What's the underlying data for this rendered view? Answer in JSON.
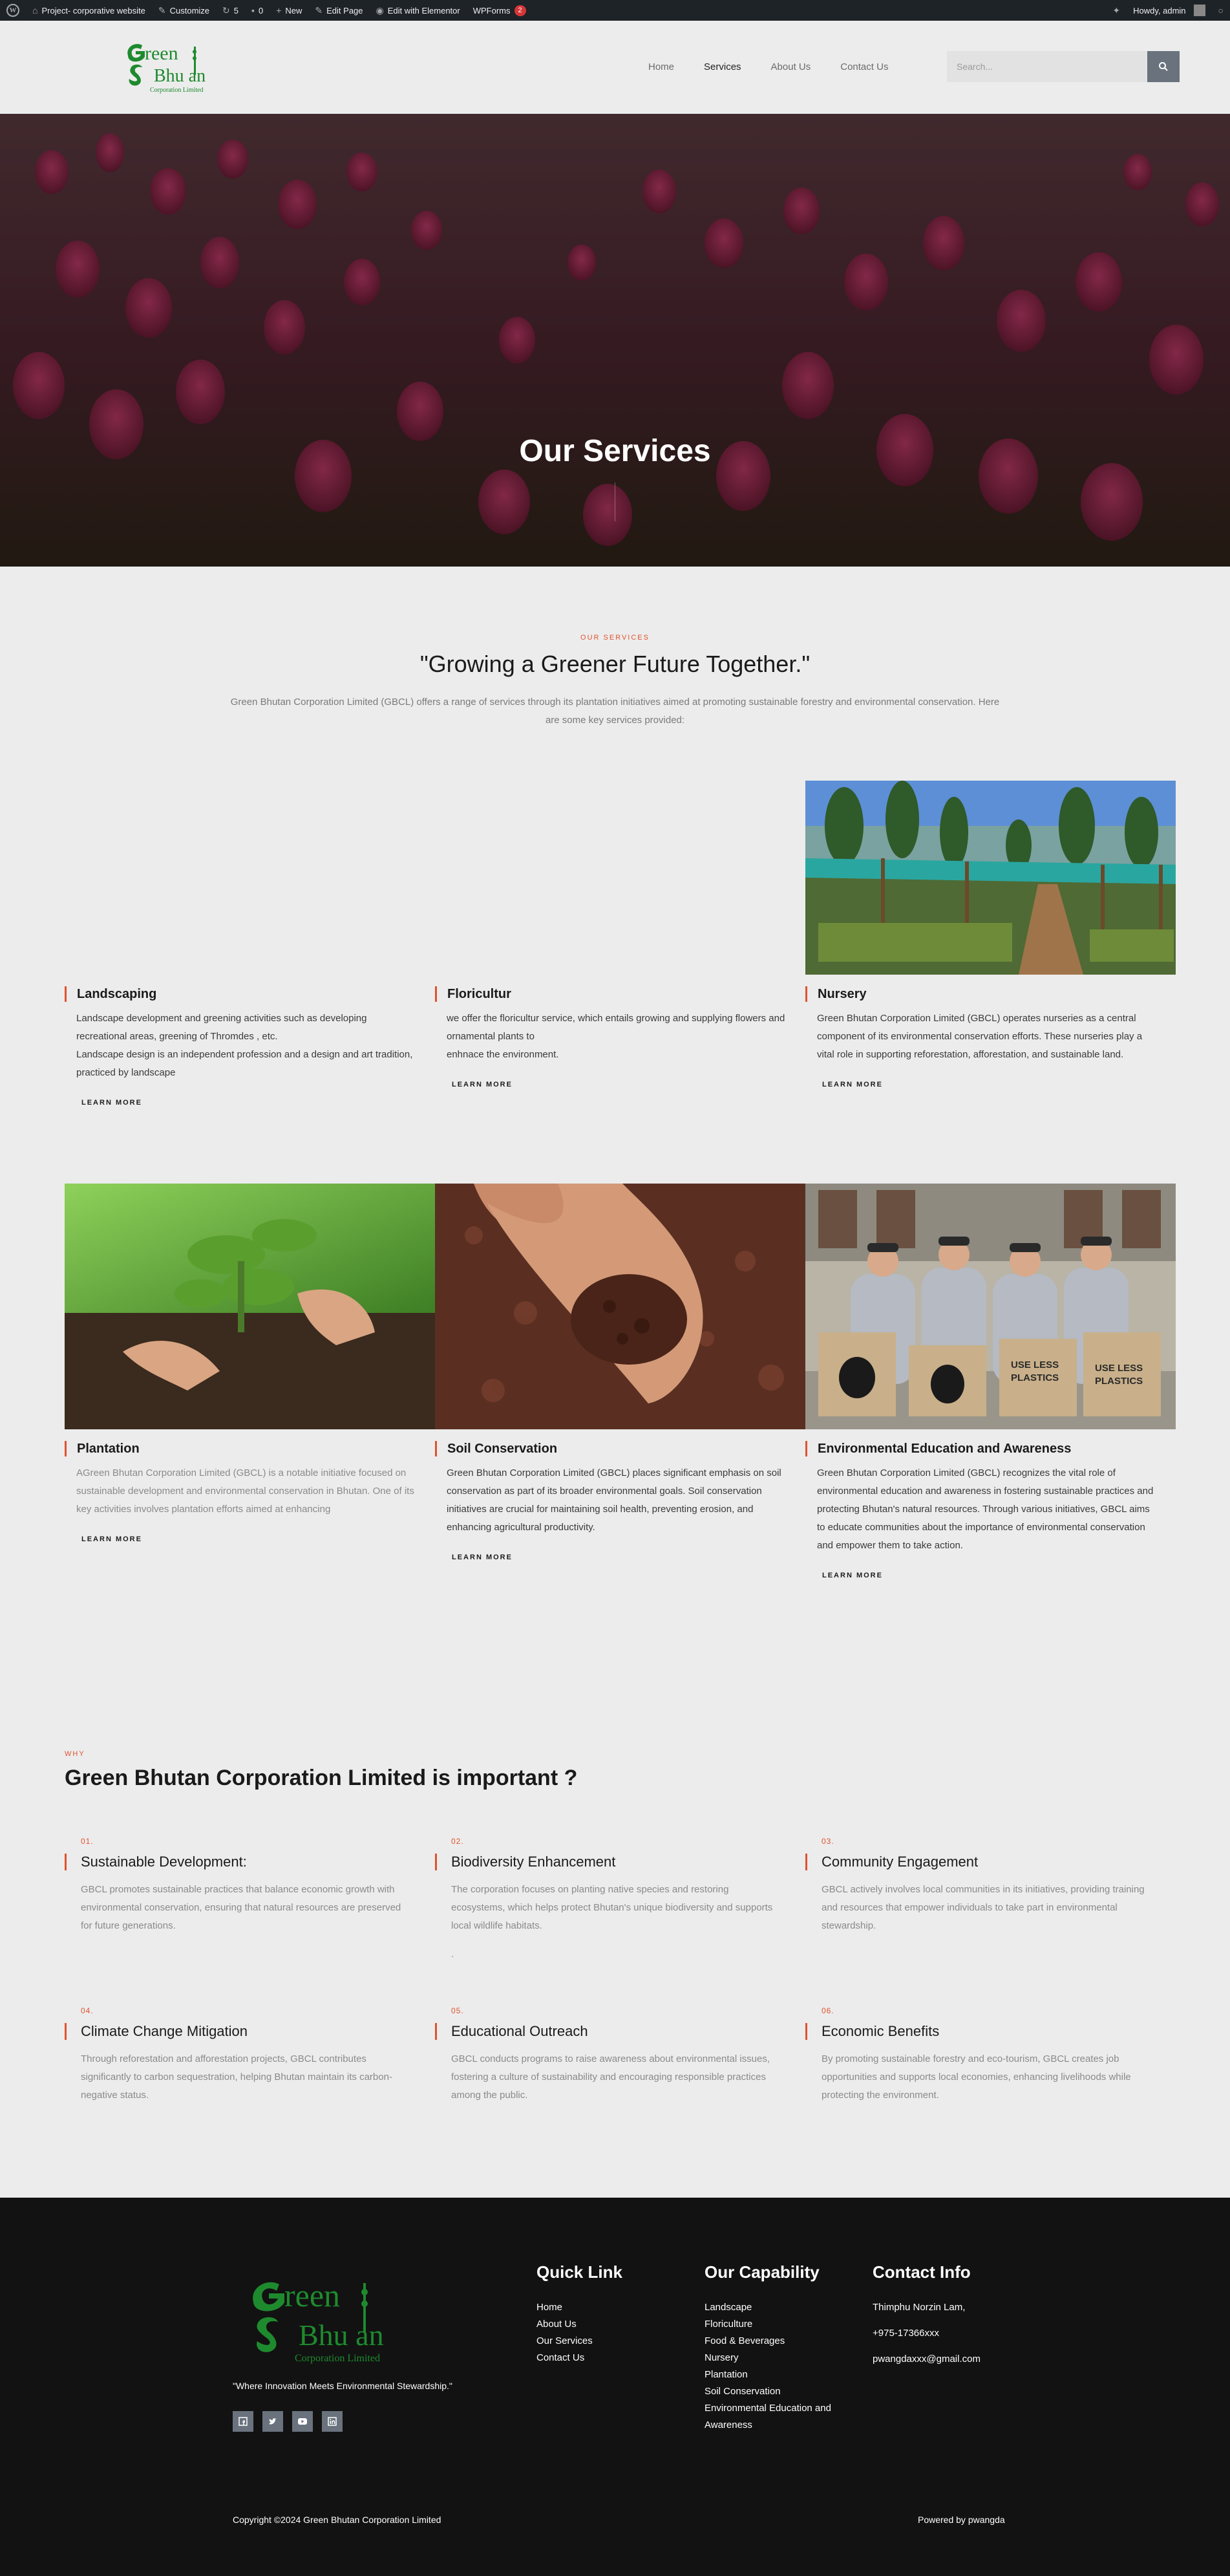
{
  "admin_bar": {
    "site_name": "Project- corporative website",
    "customize": "Customize",
    "updates_count": "5",
    "comments_count": "0",
    "new": "New",
    "edit_page": "Edit Page",
    "edit_elementor": "Edit with Elementor",
    "wpforms": "WPForms",
    "wpforms_badge": "2",
    "howdy": "Howdy, admin"
  },
  "header": {
    "logo_word1": "reen",
    "logo_word2": "Bhu an",
    "logo_sub": "Corporation Limited",
    "nav": [
      "Home",
      "Services",
      "About Us",
      "Contact Us"
    ],
    "active_nav": "Services",
    "search_placeholder": "Search..."
  },
  "hero": {
    "title": "Our Services"
  },
  "intro": {
    "eyebrow": "OUR SERVICES",
    "title": "\"Growing a Greener Future Together.\"",
    "text": "Green Bhutan Corporation Limited (GBCL) offers a range of services through its plantation initiatives aimed at promoting sustainable forestry and environmental conservation. Here are some key services provided:"
  },
  "services": [
    {
      "title": "Landscaping",
      "lines": [
        "Landscape development and greening activities such as developing recreational areas, greening of Thromdes , etc.",
        "Landscape design is an independent profession and a design and art tradition, practiced by landscape"
      ],
      "cta": "LEARN MORE"
    },
    {
      "title": "Floricultur",
      "lines": [
        "we offer the floricultur service, which entails growing and supplying flowers and ornamental plants to",
        "enhnace the environment."
      ],
      "cta": "LEARN MORE"
    },
    {
      "title": "Nursery",
      "lines": [
        "Green Bhutan Corporation Limited (GBCL) operates nurseries as a central component of its environmental conservation efforts. These nurseries play a vital role in supporting reforestation, afforestation, and sustainable land."
      ],
      "cta": "LEARN MORE"
    },
    {
      "title": "Plantation",
      "lines": [
        "AGreen Bhutan Corporation Limited (GBCL) is a notable initiative focused on sustainable development and environmental conservation in Bhutan. One of its key activities involves plantation efforts aimed at enhancing"
      ],
      "cta": "LEARN MORE"
    },
    {
      "title": "Soil Conservation",
      "lines": [
        "Green Bhutan Corporation Limited (GBCL) places significant emphasis on soil conservation as part of its broader environmental goals. Soil conservation initiatives are crucial for maintaining soil health, preventing erosion, and enhancing agricultural productivity."
      ],
      "cta": "LEARN MORE"
    },
    {
      "title": "Environmental Education and Awareness",
      "lines": [
        "Green Bhutan Corporation Limited (GBCL) recognizes the vital role of environmental education and awareness in fostering sustainable practices and protecting Bhutan's natural resources. Through various initiatives, GBCL aims to educate communities about the importance of environmental conservation and empower them to take action."
      ],
      "cta": "LEARN MORE"
    }
  ],
  "bag_text": {
    "a": "USE LESS",
    "b": "PLASTICS"
  },
  "why": {
    "eyebrow": "WHY",
    "title": "Green Bhutan Corporation Limited is important ?",
    "items": [
      {
        "num": "01.",
        "title": "Sustainable Development:",
        "text": "GBCL promotes sustainable practices that balance economic growth with environmental conservation, ensuring that natural resources are preserved for future generations."
      },
      {
        "num": "02.",
        "title": "Biodiversity Enhancement",
        "text": "The corporation focuses on planting native species and restoring ecosystems, which helps protect Bhutan's unique biodiversity and supports local wildlife habitats.",
        "extra": "."
      },
      {
        "num": "03.",
        "title": "Community Engagement",
        "text": "GBCL actively involves local communities in its initiatives, providing training and resources that empower individuals to take part in environmental stewardship."
      },
      {
        "num": "04.",
        "title": "Climate Change Mitigation",
        "text": "Through reforestation and afforestation projects, GBCL contributes significantly to carbon sequestration, helping Bhutan maintain its carbon-negative status."
      },
      {
        "num": "05.",
        "title": "Educational Outreach",
        "text": "GBCL conducts programs to raise awareness about environmental issues, fostering a culture of sustainability and encouraging responsible practices among the public."
      },
      {
        "num": "06.",
        "title": "Economic Benefits",
        "text": "By promoting sustainable forestry and eco-tourism, GBCL creates job opportunities and supports local economies, enhancing livelihoods while protecting the environment."
      }
    ]
  },
  "footer": {
    "tagline": "\"Where Innovation Meets Environmental Stewardship.\"",
    "quick_title": "Quick Link",
    "quick_links": [
      "Home",
      "About Us",
      "Our Services",
      "Contact Us"
    ],
    "capability_title": "Our Capability",
    "capabilities": [
      "Landscape",
      "Floriculture",
      "Food & Beverages",
      "Nursery",
      "Plantation",
      "Soil Conservation",
      "Environmental Education and Awareness"
    ],
    "contact_title": "Contact Info",
    "contact": [
      "Thimphu Norzin Lam,",
      "+975-17366xxx",
      "pwangdaxxx@gmail.com"
    ],
    "copyright": "Copyright ©2024 Green Bhutan Corporation Limited",
    "powered": "Powered by pwangda"
  },
  "colors": {
    "accent": "#e0522f",
    "brand_green": "#1e8a2e",
    "footer_bg": "#121212",
    "button_gray": "#69727d"
  }
}
